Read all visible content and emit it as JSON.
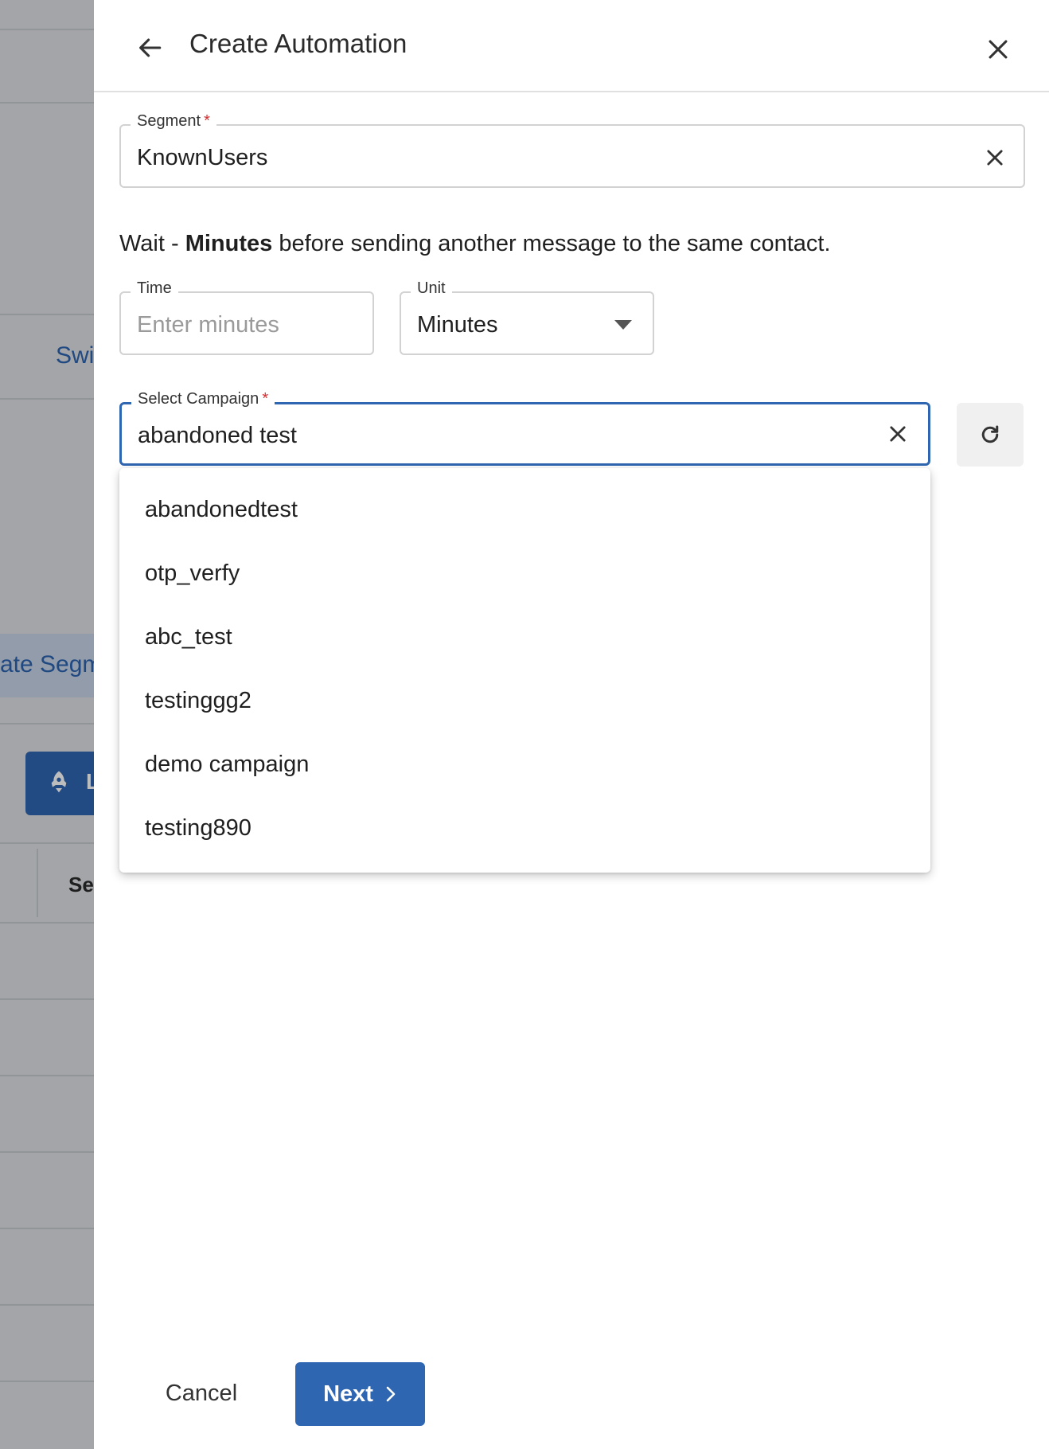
{
  "background": {
    "switch_text": "Swi",
    "segment_button_text": "ate Segm",
    "launch_button_letter": "L",
    "table_header": "Se"
  },
  "drawer": {
    "title": "Create Automation",
    "segment": {
      "label": "Segment",
      "required_mark": "*",
      "value": "KnownUsers"
    },
    "wait": {
      "prefix": "Wait - ",
      "unit_bold": "Minutes",
      "suffix": " before sending another message to the same contact."
    },
    "time": {
      "label": "Time",
      "placeholder": "Enter minutes"
    },
    "unit": {
      "label": "Unit",
      "value": "Minutes"
    },
    "campaign": {
      "label": "Select Campaign",
      "required_mark": "*",
      "value": "abandoned test",
      "options": [
        "abandonedtest",
        "otp_verfy",
        "abc_test",
        "testinggg2",
        "demo campaign",
        "testing890"
      ]
    },
    "footer": {
      "cancel_label": "Cancel",
      "next_label": "Next"
    }
  },
  "colors": {
    "primary": "#2f66b1",
    "required": "#d32f2f",
    "overlay": "rgba(0,0,0,0.26)"
  },
  "icons": [
    "arrow-left-icon",
    "close-icon",
    "clear-icon",
    "caret-down-icon",
    "refresh-icon",
    "chevron-right-icon",
    "rocket-icon"
  ]
}
